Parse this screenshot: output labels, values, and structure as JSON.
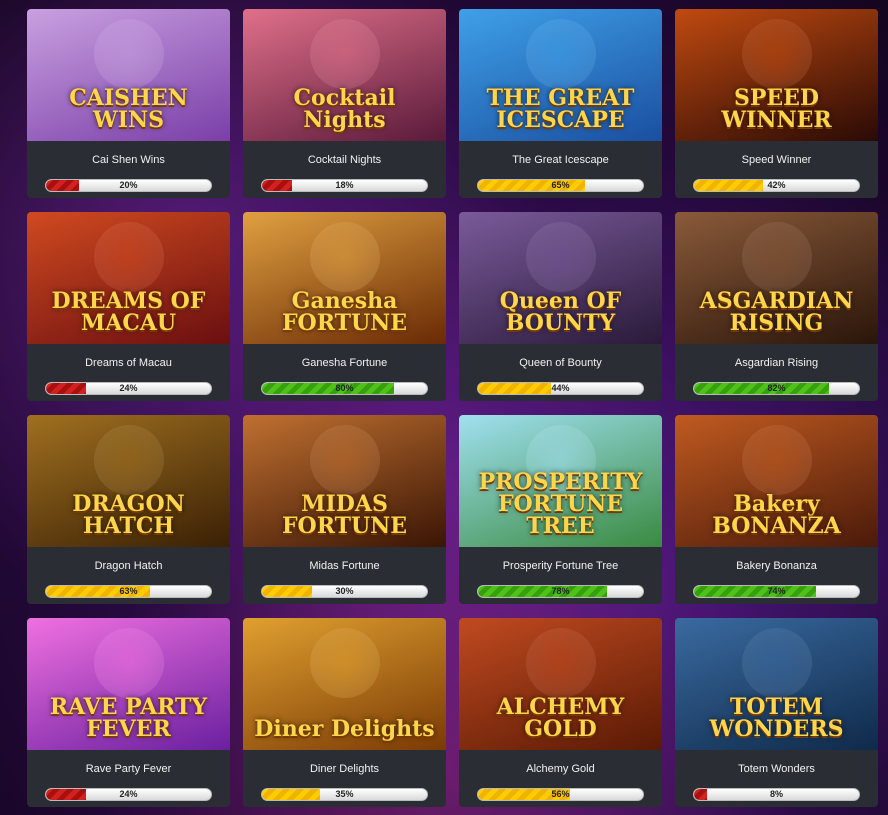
{
  "games": [
    {
      "name": "Cai Shen Wins",
      "logo": "CAISHEN WINS",
      "percent": 20,
      "percent_label": "20%",
      "level": "red",
      "bg": [
        "#c9a0e0",
        "#7a3fa8"
      ]
    },
    {
      "name": "Cocktail Nights",
      "logo": "Cocktail Nights",
      "percent": 18,
      "percent_label": "18%",
      "level": "red",
      "bg": [
        "#e0708a",
        "#5a1a3a"
      ]
    },
    {
      "name": "The Great Icescape",
      "logo": "THE GREAT ICESCAPE",
      "percent": 65,
      "percent_label": "65%",
      "level": "yellow",
      "bg": [
        "#3fa0e8",
        "#1a4fa0"
      ]
    },
    {
      "name": "Speed Winner",
      "logo": "SPEED WINNER",
      "percent": 42,
      "percent_label": "42%",
      "level": "yellow",
      "bg": [
        "#c04a10",
        "#2a0a05"
      ]
    },
    {
      "name": "Dreams of Macau",
      "logo": "DREAMS OF MACAU",
      "percent": 24,
      "percent_label": "24%",
      "level": "red",
      "bg": [
        "#d04a20",
        "#6a0f10"
      ]
    },
    {
      "name": "Ganesha Fortune",
      "logo": "Ganesha FORTUNE",
      "percent": 80,
      "percent_label": "80%",
      "level": "green",
      "bg": [
        "#e0a040",
        "#6a2a05"
      ]
    },
    {
      "name": "Queen of Bounty",
      "logo": "Queen OF BOUNTY",
      "percent": 44,
      "percent_label": "44%",
      "level": "yellow",
      "bg": [
        "#7a5a9a",
        "#2a1a3a"
      ]
    },
    {
      "name": "Asgardian Rising",
      "logo": "ASGARDIAN RISING",
      "percent": 82,
      "percent_label": "82%",
      "level": "green",
      "bg": [
        "#8a5a3a",
        "#2a150a"
      ]
    },
    {
      "name": "Dragon Hatch",
      "logo": "DRAGON HATCH",
      "percent": 63,
      "percent_label": "63%",
      "level": "yellow",
      "bg": [
        "#a07020",
        "#3a2005"
      ]
    },
    {
      "name": "Midas Fortune",
      "logo": "MIDAS FORTUNE",
      "percent": 30,
      "percent_label": "30%",
      "level": "yellow",
      "bg": [
        "#c07030",
        "#3a1505"
      ]
    },
    {
      "name": "Prosperity Fortune Tree",
      "logo": "PROSPERITY FORTUNE TREE",
      "percent": 78,
      "percent_label": "78%",
      "level": "green",
      "bg": [
        "#a0e0f0",
        "#3a8a40"
      ]
    },
    {
      "name": "Bakery Bonanza",
      "logo": "Bakery BONANZA",
      "percent": 74,
      "percent_label": "74%",
      "level": "green",
      "bg": [
        "#c05a20",
        "#4a1a0a"
      ]
    },
    {
      "name": "Rave Party Fever",
      "logo": "RAVE PARTY FEVER",
      "percent": 24,
      "percent_label": "24%",
      "level": "red",
      "bg": [
        "#f070e0",
        "#6a20a0"
      ]
    },
    {
      "name": "Diner Delights",
      "logo": "Diner Delights",
      "percent": 35,
      "percent_label": "35%",
      "level": "yellow",
      "bg": [
        "#e0a030",
        "#7a3a05"
      ]
    },
    {
      "name": "Alchemy Gold",
      "logo": "ALCHEMY GOLD",
      "percent": 56,
      "percent_label": "56%",
      "level": "yellow",
      "bg": [
        "#c04a20",
        "#5a1a05"
      ]
    },
    {
      "name": "Totem Wonders",
      "logo": "TOTEM WONDERS",
      "percent": 8,
      "percent_label": "8%",
      "level": "red",
      "bg": [
        "#3a6aa0",
        "#0f2a4a"
      ]
    }
  ]
}
